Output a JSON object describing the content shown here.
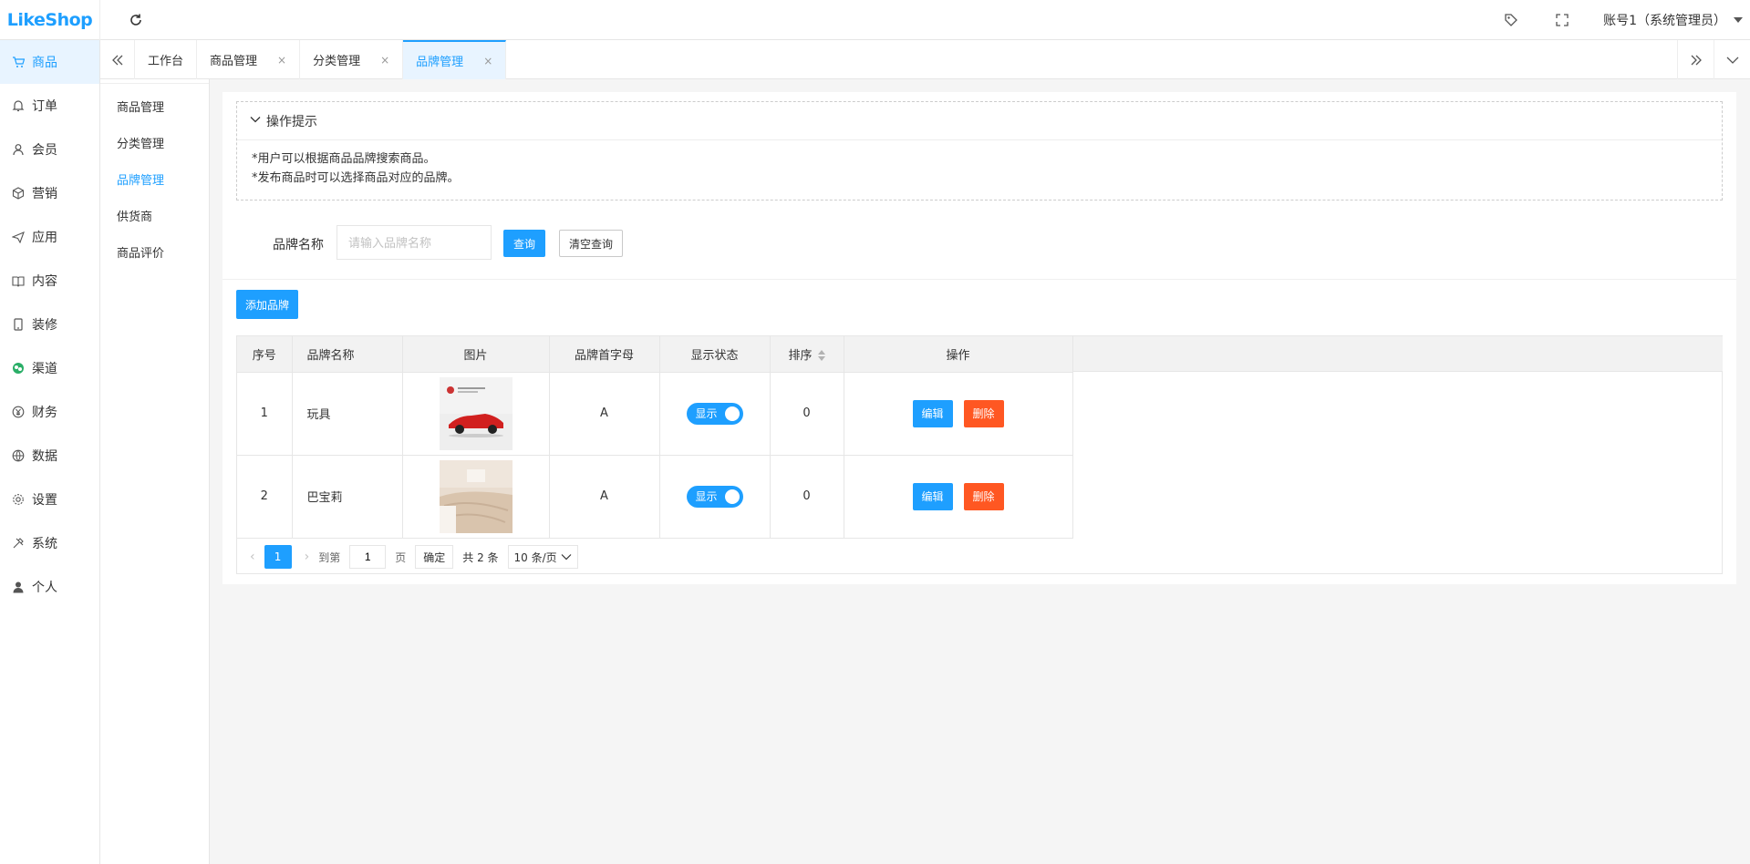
{
  "app": {
    "logo": "LikeShop"
  },
  "header": {
    "account": "账号1（系统管理员）"
  },
  "sidebar": {
    "items": [
      {
        "label": "商品",
        "icon": "cart-icon"
      },
      {
        "label": "订单",
        "icon": "bell-icon"
      },
      {
        "label": "会员",
        "icon": "user-icon"
      },
      {
        "label": "营销",
        "icon": "cube-icon"
      },
      {
        "label": "应用",
        "icon": "send-icon"
      },
      {
        "label": "内容",
        "icon": "book-icon"
      },
      {
        "label": "装修",
        "icon": "tablet-icon"
      },
      {
        "label": "渠道",
        "icon": "wechat-icon"
      },
      {
        "label": "财务",
        "icon": "yen-icon"
      },
      {
        "label": "数据",
        "icon": "globe-icon"
      },
      {
        "label": "设置",
        "icon": "gear-icon"
      },
      {
        "label": "系统",
        "icon": "tools-icon"
      },
      {
        "label": "个人",
        "icon": "person-icon"
      }
    ]
  },
  "subnav": {
    "title": "商品",
    "items": [
      "商品管理",
      "分类管理",
      "品牌管理",
      "供货商",
      "商品评价"
    ]
  },
  "tabs": {
    "items": [
      {
        "label": "工作台"
      },
      {
        "label": "商品管理"
      },
      {
        "label": "分类管理"
      },
      {
        "label": "品牌管理"
      }
    ],
    "close_glyph": "×"
  },
  "tips": {
    "title": "操作提示",
    "lines": [
      "*用户可以根据商品品牌搜索商品。",
      "*发布商品时可以选择商品对应的品牌。"
    ]
  },
  "search": {
    "label": "品牌名称",
    "placeholder": "请输入品牌名称",
    "query_label": "查询",
    "clear_label": "清空查询"
  },
  "add_button": "添加品牌",
  "table": {
    "headers": [
      "序号",
      "品牌名称",
      "图片",
      "品牌首字母",
      "显示状态",
      "排序",
      "操作"
    ],
    "rows": [
      {
        "index": "1",
        "name": "玩具",
        "letter": "A",
        "status": "显示",
        "sort": "0"
      },
      {
        "index": "2",
        "name": "巴宝莉",
        "letter": "A",
        "status": "显示",
        "sort": "0"
      }
    ],
    "edit_label": "编辑",
    "delete_label": "删除"
  },
  "pager": {
    "current": "1",
    "goto_label": "到第",
    "goto_value": "1",
    "page_unit": "页",
    "ok_label": "确定",
    "total": "共 2 条",
    "per_page": "10 条/页"
  },
  "colors": {
    "primary": "#1e9fff",
    "danger": "#ff5722"
  }
}
